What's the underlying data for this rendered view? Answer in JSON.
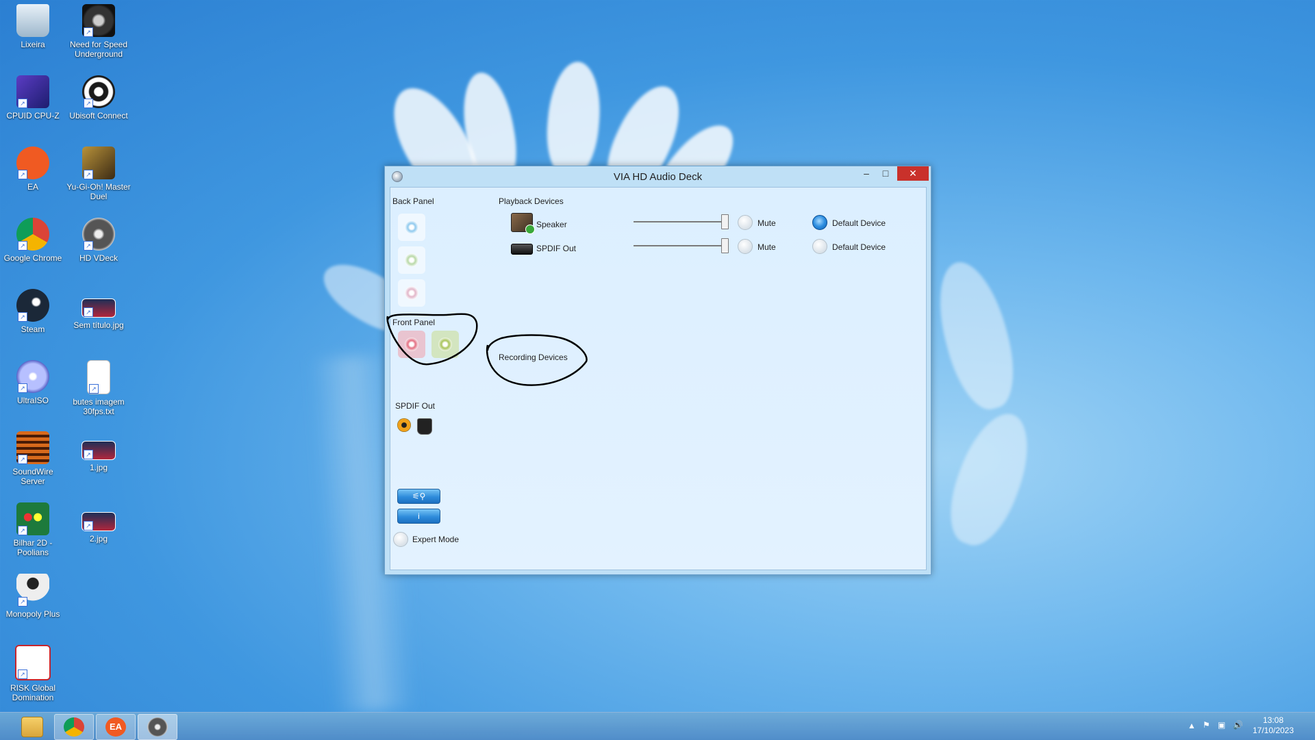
{
  "desktop": {
    "icons": [
      {
        "label": "Lixeira",
        "icon": "recycle-bin-icon"
      },
      {
        "label": "Need for Speed Underground",
        "icon": "game-nfs-icon"
      },
      {
        "label": "CPUID CPU-Z",
        "icon": "cpuz-icon"
      },
      {
        "label": "Ubisoft Connect",
        "icon": "ubisoft-icon"
      },
      {
        "label": "EA",
        "icon": "ea-icon"
      },
      {
        "label": "Yu-Gi-Oh! Master Duel",
        "icon": "yugioh-icon"
      },
      {
        "label": "Google Chrome",
        "icon": "chrome-icon"
      },
      {
        "label": "HD VDeck",
        "icon": "hdvdeck-icon"
      },
      {
        "label": "Steam",
        "icon": "steam-icon"
      },
      {
        "label": "Sem título.jpg",
        "icon": "image-file-icon"
      },
      {
        "label": "UltraISO",
        "icon": "ultraiso-icon"
      },
      {
        "label": "butes imagem 30fps.txt",
        "icon": "text-file-icon"
      },
      {
        "label": "SoundWire Server",
        "icon": "soundwire-icon"
      },
      {
        "label": "1.jpg",
        "icon": "image-file-icon"
      },
      {
        "label": "Bilhar 2D - Poolians",
        "icon": "pool-game-icon"
      },
      {
        "label": "2.jpg",
        "icon": "image-file-icon"
      },
      {
        "label": "Monopoly Plus",
        "icon": "monopoly-icon"
      },
      {
        "label": "RISK Global Domination",
        "icon": "risk-icon"
      }
    ]
  },
  "window": {
    "title": "VIA HD Audio Deck",
    "controls": {
      "minimize": "–",
      "maximize": "□",
      "close": "✕"
    },
    "back_panel_label": "Back Panel",
    "front_panel_label": "Front Panel",
    "spdif_label": "SPDIF Out",
    "playback_label": "Playback Devices",
    "recording_label": "Recording Devices",
    "devices": [
      {
        "name": "Speaker",
        "mute_label": "Mute",
        "default_label": "Default Device",
        "volume": 1.0,
        "muted": false,
        "is_default": true
      },
      {
        "name": "SPDIF Out",
        "mute_label": "Mute",
        "default_label": "Default Device",
        "volume": 1.0,
        "muted": false,
        "is_default": false
      }
    ],
    "expert_mode_label": "Expert Mode"
  },
  "colors": {
    "jack_blue": "#8ec9ee",
    "jack_green": "#b8d8a6",
    "jack_pink": "#e2b5c8",
    "jack_front_pink": "#e46f82",
    "jack_front_green": "#a9c45a",
    "accent": "#2d8ee0"
  },
  "taskbar": {
    "pinned": [
      "file-explorer-icon",
      "chrome-icon",
      "ea-icon",
      "hdvdeck-icon"
    ],
    "clock_time": "13:08",
    "clock_date": "17/10/2023"
  }
}
